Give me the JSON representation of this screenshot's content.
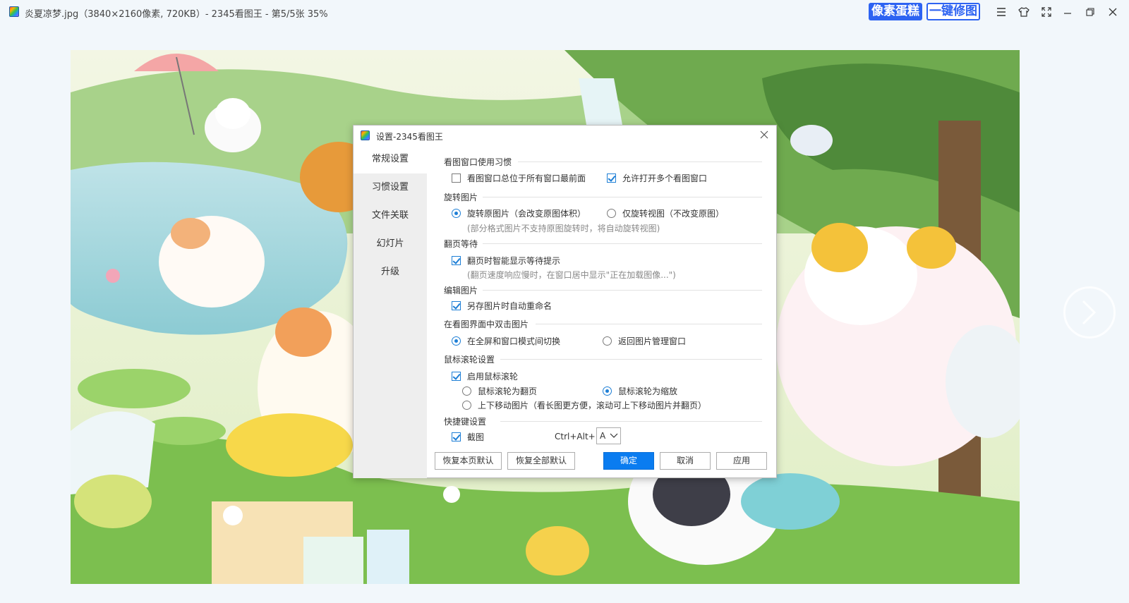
{
  "window": {
    "title": "炎夏凉梦.jpg（3840×2160像素, 720KB）- 2345看图王 - 第5/5张 35%",
    "pixel_cake_label": "像素蛋糕",
    "one_click_fix_label": "一键修图",
    "controls": [
      "menu-icon",
      "skin-icon",
      "fullscreen-icon",
      "minimize-icon",
      "restore-icon",
      "close-icon"
    ]
  },
  "dialog": {
    "title": "设置-2345看图王",
    "sidebar": [
      "常规设置",
      "习惯设置",
      "文件关联",
      "幻灯片",
      "升级"
    ],
    "active_tab": "常规设置",
    "sections": {
      "viewer_habits": {
        "title": "看图窗口使用习惯",
        "always_on_top": "看图窗口总位于所有窗口最前面",
        "always_on_top_checked": false,
        "multi_window": "允许打开多个看图窗口",
        "multi_window_checked": true
      },
      "rotate": {
        "title": "旋转图片",
        "rotate_original": "旋转原图片（会改变原图体积）",
        "rotate_view": "仅旋转视图（不改变原图）",
        "selected": "rotate_original",
        "hint": "(部分格式图片不支持原图旋转时，将自动旋转视图)"
      },
      "page_wait": {
        "title": "翻页等待",
        "smart_wait": "翻页时智能显示等待提示",
        "smart_wait_checked": true,
        "hint": "(翻页速度响应慢时，在窗口居中显示\"正在加载图像...\")"
      },
      "edit": {
        "title": "编辑图片",
        "auto_rename": "另存图片时自动重命名",
        "auto_rename_checked": true
      },
      "double_click": {
        "title": "在看图界面中双击图片",
        "toggle_fullscreen": "在全屏和窗口模式间切换",
        "return_manager": "返回图片管理窗口",
        "selected": "toggle_fullscreen"
      },
      "mouse_wheel": {
        "title": "鼠标滚轮设置",
        "enable": "启用鼠标滚轮",
        "enable_checked": true,
        "page": "鼠标滚轮为翻页",
        "zoom": "鼠标滚轮为缩放",
        "move": "上下移动图片（看长图更方便，滚动可上下移动图片并翻页）",
        "selected": "zoom"
      },
      "hotkey": {
        "title": "快捷键设置",
        "screenshot": "截图",
        "screenshot_checked": true,
        "combo_label": "Ctrl+Alt+",
        "key": "A"
      }
    },
    "buttons": {
      "restore_page": "恢复本页默认",
      "restore_all": "恢复全部默认",
      "ok": "确定",
      "cancel": "取消",
      "apply": "应用"
    }
  },
  "colors": {
    "accent": "#0a7cf0",
    "brand_blue": "#2d63f2",
    "sidebar_bg": "#eeeeee",
    "window_bg": "#f2f7fb"
  }
}
